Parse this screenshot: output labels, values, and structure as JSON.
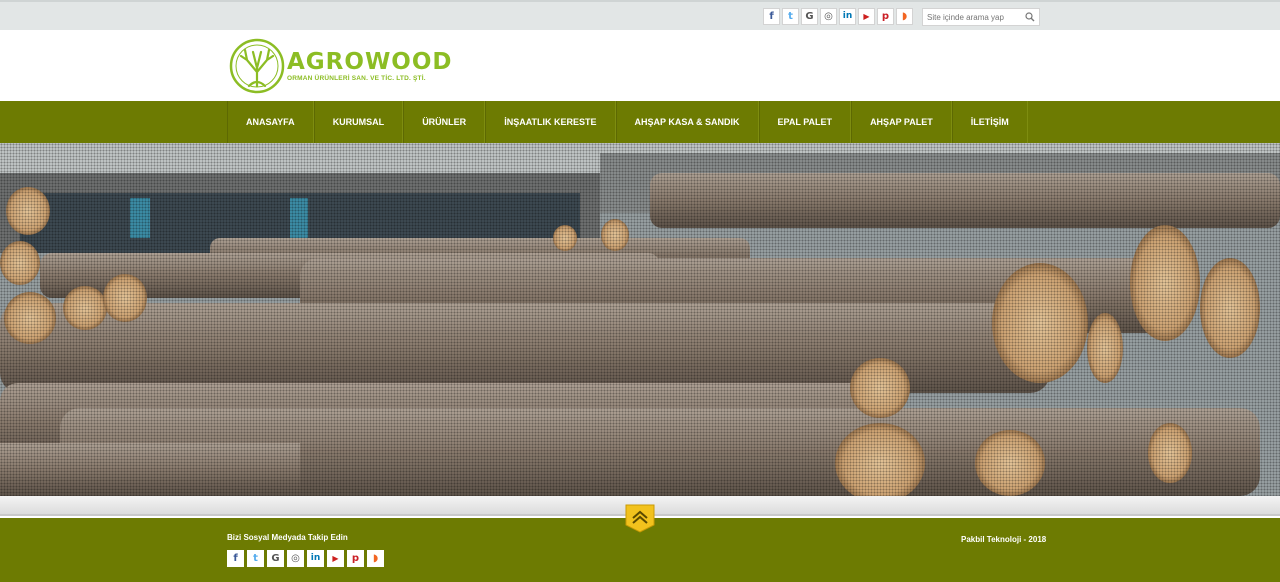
{
  "topbar": {
    "social": [
      {
        "icon": "facebook-icon",
        "glyph": "f",
        "color": "#3b5998"
      },
      {
        "icon": "twitter-icon",
        "glyph": "t",
        "color": "#55acee"
      },
      {
        "icon": "google-plus-icon",
        "glyph": "G",
        "color": "#555555"
      },
      {
        "icon": "instagram-icon",
        "glyph": "◎",
        "color": "#555555"
      },
      {
        "icon": "linkedin-icon",
        "glyph": "in",
        "color": "#0077b5"
      },
      {
        "icon": "youtube-icon",
        "glyph": "▶",
        "color": "#cd201f"
      },
      {
        "icon": "pinterest-icon",
        "glyph": "p",
        "color": "#cb2027"
      },
      {
        "icon": "rss-icon",
        "glyph": "◗",
        "color": "#f26522"
      }
    ],
    "search_placeholder": "Site içinde arama yap"
  },
  "header": {
    "brand": "AGROWOOD",
    "subtitle": "ORMAN ÜRÜNLERİ SAN. VE TİC. LTD. ŞTİ."
  },
  "nav": {
    "items": [
      "ANASAYFA",
      "KURUMSAL",
      "ÜRÜNLER",
      "İNŞAATLIK KERESTE",
      "AHŞAP KASA & SANDIK",
      "EPAL PALET",
      "AHŞAP PALET",
      "İLETİŞİM"
    ]
  },
  "footer": {
    "follow_label": "Bizi Sosyal Medyada Takip Edin",
    "credit": "Pakbil Teknoloji - 2018"
  },
  "colors": {
    "brand_green": "#8cbd24",
    "nav_olive": "#6d7b02",
    "to_top": "#f2c21d"
  }
}
